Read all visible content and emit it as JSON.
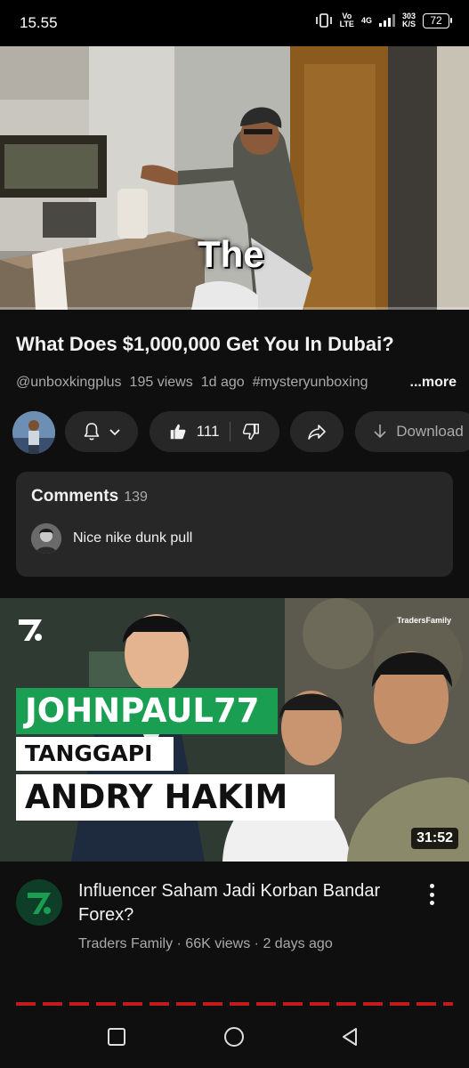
{
  "status_bar": {
    "time": "15.55",
    "network_volte_top": "Vo",
    "network_volte_bottom": "LTE",
    "network_type": "4G",
    "speed_value": "303",
    "speed_unit": "K/S",
    "battery": "72"
  },
  "player": {
    "caption": "The",
    "progress_fraction": 0.0
  },
  "video": {
    "title": "What Does $1,000,000 Get You In Dubai?",
    "channel_handle": "@unboxkingplus",
    "views": "195 views",
    "age": "1d ago",
    "hashtag": "#mysteryunboxing",
    "more_label": "...more"
  },
  "actions": {
    "likes": "111",
    "download_label": "Download"
  },
  "comments": {
    "header": "Comments",
    "count": "139",
    "top_comment": "Nice nike dunk pull"
  },
  "next_video": {
    "thumb_brand": "TradersFamily",
    "banner_line1": "JOHNPAUL77",
    "banner_line2": "TANGGAPI",
    "banner_line3": "ANDRY HAKIM",
    "duration": "31:52",
    "title": "Influencer Saham Jadi Korban Bandar Forex?",
    "meta": "Traders Family · 66K views · 2 days ago"
  },
  "colors": {
    "background": "#0f0f0f",
    "pill": "#272727",
    "accent_green": "#1a9e52",
    "progress_red": "#ff0000"
  },
  "icons": [
    "vibrate-icon",
    "signal-icon",
    "battery-icon",
    "bell-icon",
    "chevron-down-icon",
    "thumbs-up-icon",
    "thumbs-down-icon",
    "share-icon",
    "download-icon",
    "more-vert-icon",
    "recents-icon",
    "home-icon",
    "back-icon"
  ]
}
